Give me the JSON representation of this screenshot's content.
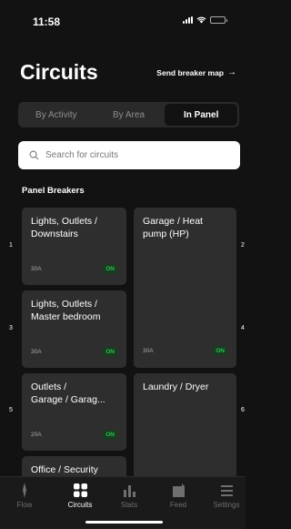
{
  "status_bar": {
    "time": "11:58"
  },
  "header": {
    "title": "Circuits",
    "breaker_map_link": "Send breaker map"
  },
  "tabs": [
    {
      "label": "By Activity",
      "active": false
    },
    {
      "label": "By Area",
      "active": false
    },
    {
      "label": "In Panel",
      "active": true
    }
  ],
  "search": {
    "placeholder": "Search for circuits",
    "value": ""
  },
  "section_heading": "Panel Breakers",
  "panel_numbers": [
    "1",
    "2",
    "3",
    "4",
    "5",
    "6"
  ],
  "breakers": [
    {
      "name": "Lights, Outlets /\nDownstairs",
      "amperage": "30A",
      "status": "ON"
    },
    {
      "name": "Garage / Heat\npump (HP)",
      "amperage": "",
      "status": ""
    },
    {
      "name": "Lights, Outlets /\nMaster bedroom",
      "amperage": "30A",
      "status": "ON"
    },
    {
      "name": "",
      "amperage": "30A",
      "status": "ON"
    },
    {
      "name": "Outlets /\nGarage / Garag...",
      "amperage": "20A",
      "status": "ON"
    },
    {
      "name": "Laundry / Dryer",
      "amperage": "",
      "status": ""
    },
    {
      "name": "Office / Security",
      "amperage": "",
      "status": ""
    }
  ],
  "tab_bar": [
    {
      "label": "Flow",
      "icon": "flow-icon",
      "active": false
    },
    {
      "label": "Circuits",
      "icon": "circuits-icon",
      "active": true
    },
    {
      "label": "Stats",
      "icon": "stats-icon",
      "active": false
    },
    {
      "label": "Feed",
      "icon": "feed-icon",
      "active": false
    },
    {
      "label": "Settings",
      "icon": "settings-icon",
      "active": false
    }
  ],
  "colors": {
    "background": "#121212",
    "card": "#2e2e2e",
    "on_green": "#27c04a",
    "tab_inactive": "#6f6f6f"
  }
}
